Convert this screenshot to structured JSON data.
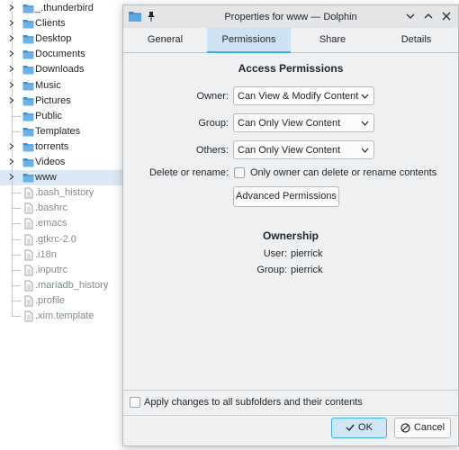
{
  "file_tree": [
    {
      "label": "_.thunderbird",
      "icon": "folder-icon",
      "expandable": true
    },
    {
      "label": "Clients",
      "icon": "folder-icon",
      "expandable": true
    },
    {
      "label": "Desktop",
      "icon": "desktop-folder-icon",
      "expandable": true
    },
    {
      "label": "Documents",
      "icon": "documents-folder-icon",
      "expandable": true
    },
    {
      "label": "Downloads",
      "icon": "downloads-folder-icon",
      "expandable": true
    },
    {
      "label": "Music",
      "icon": "music-folder-icon",
      "expandable": true
    },
    {
      "label": "Pictures",
      "icon": "pictures-folder-icon",
      "expandable": true
    },
    {
      "label": "Public",
      "icon": "public-folder-icon",
      "expandable": false
    },
    {
      "label": "Templates",
      "icon": "templates-folder-icon",
      "expandable": false
    },
    {
      "label": "torrents",
      "icon": "folder-icon",
      "expandable": true
    },
    {
      "label": "Videos",
      "icon": "videos-folder-icon",
      "expandable": true
    },
    {
      "label": "www",
      "icon": "folder-icon",
      "expandable": true,
      "selected": true
    },
    {
      "label": ".bash_history",
      "icon": "text-file-icon",
      "hidden": true
    },
    {
      "label": ".bashrc",
      "icon": "text-file-icon",
      "hidden": true
    },
    {
      "label": ".emacs",
      "icon": "text-file-icon",
      "hidden": true
    },
    {
      "label": ".gtkrc-2.0",
      "icon": "text-file-icon",
      "hidden": true
    },
    {
      "label": ".i18n",
      "icon": "text-file-icon",
      "hidden": true
    },
    {
      "label": ".inputrc",
      "icon": "text-file-icon",
      "hidden": true
    },
    {
      "label": ".mariadb_history",
      "icon": "text-file-icon",
      "hidden": true
    },
    {
      "label": ".profile",
      "icon": "text-file-icon",
      "hidden": true
    },
    {
      "label": ".xim.template",
      "icon": "script-file-icon",
      "hidden": true
    }
  ],
  "dialog": {
    "title": "Properties for www — Dolphin",
    "tabs": [
      {
        "label": "General",
        "active": false
      },
      {
        "label": "Permissions",
        "active": true
      },
      {
        "label": "Share",
        "active": false
      },
      {
        "label": "Details",
        "active": false
      }
    ],
    "access": {
      "heading": "Access Permissions",
      "owner_label": "Owner:",
      "owner_value": "Can View & Modify Content",
      "group_label": "Group:",
      "group_value": "Can Only View Content",
      "others_label": "Others:",
      "others_value": "Can Only View Content",
      "delete_label": "Delete or rename:",
      "delete_checkbox": "Only owner can delete or rename contents",
      "delete_checked": false,
      "advanced_button": "Advanced Permissions"
    },
    "ownership": {
      "heading": "Ownership",
      "user_label": "User:",
      "user_value": "pierrick",
      "group_label": "Group:",
      "group_value": "pierrick"
    },
    "apply_recursive": "Apply changes to all subfolders and their contents",
    "apply_recursive_checked": false,
    "ok_button": "OK",
    "cancel_button": "Cancel"
  },
  "colors": {
    "accent": "#3daee9",
    "folder": "#3d8fd1",
    "selection": "#dbe9f6"
  }
}
